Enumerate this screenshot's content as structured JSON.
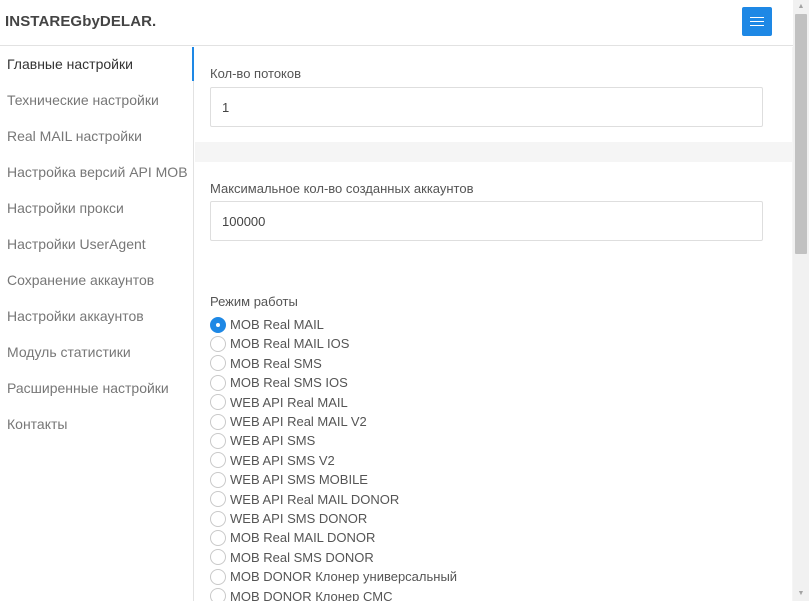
{
  "header": {
    "brand": "INSTAREGbyDELAR.",
    "menu_icon": "hamburger-icon",
    "accent_color": "#1e88e5"
  },
  "sidebar": {
    "items": [
      {
        "label": "Главные настройки",
        "active": true
      },
      {
        "label": "Технические настройки"
      },
      {
        "label": "Real MAIL настройки"
      },
      {
        "label": "Настройка версий API MOB"
      },
      {
        "label": "Настройки прокси"
      },
      {
        "label": "Настройки UserAgent"
      },
      {
        "label": "Сохранение аккаунтов"
      },
      {
        "label": "Настройки аккаунтов"
      },
      {
        "label": "Модуль статистики"
      },
      {
        "label": "Расширенные настройки"
      },
      {
        "label": "Контакты"
      }
    ]
  },
  "main": {
    "threads": {
      "label": "Кол-во потоков",
      "value": "1"
    },
    "max_accounts": {
      "label": "Максимальное кол-во созданных аккаунтов",
      "value": "100000"
    },
    "mode": {
      "label": "Режим работы",
      "selected": "MOB Real MAIL",
      "options": [
        "MOB Real MAIL",
        "MOB Real MAIL IOS",
        "MOB Real SMS",
        "MOB Real SMS IOS",
        "WEB API Real MAIL",
        "WEB API Real MAIL V2",
        "WEB API SMS",
        "WEB API SMS V2",
        "WEB API SMS MOBILE",
        "WEB API Real MAIL DONOR",
        "WEB API SMS DONOR",
        "MOB Real MAIL DONOR",
        "MOB Real SMS DONOR",
        "MOB DONOR Клонер универсальный",
        "MOB DONOR Клонер СМС"
      ]
    }
  }
}
